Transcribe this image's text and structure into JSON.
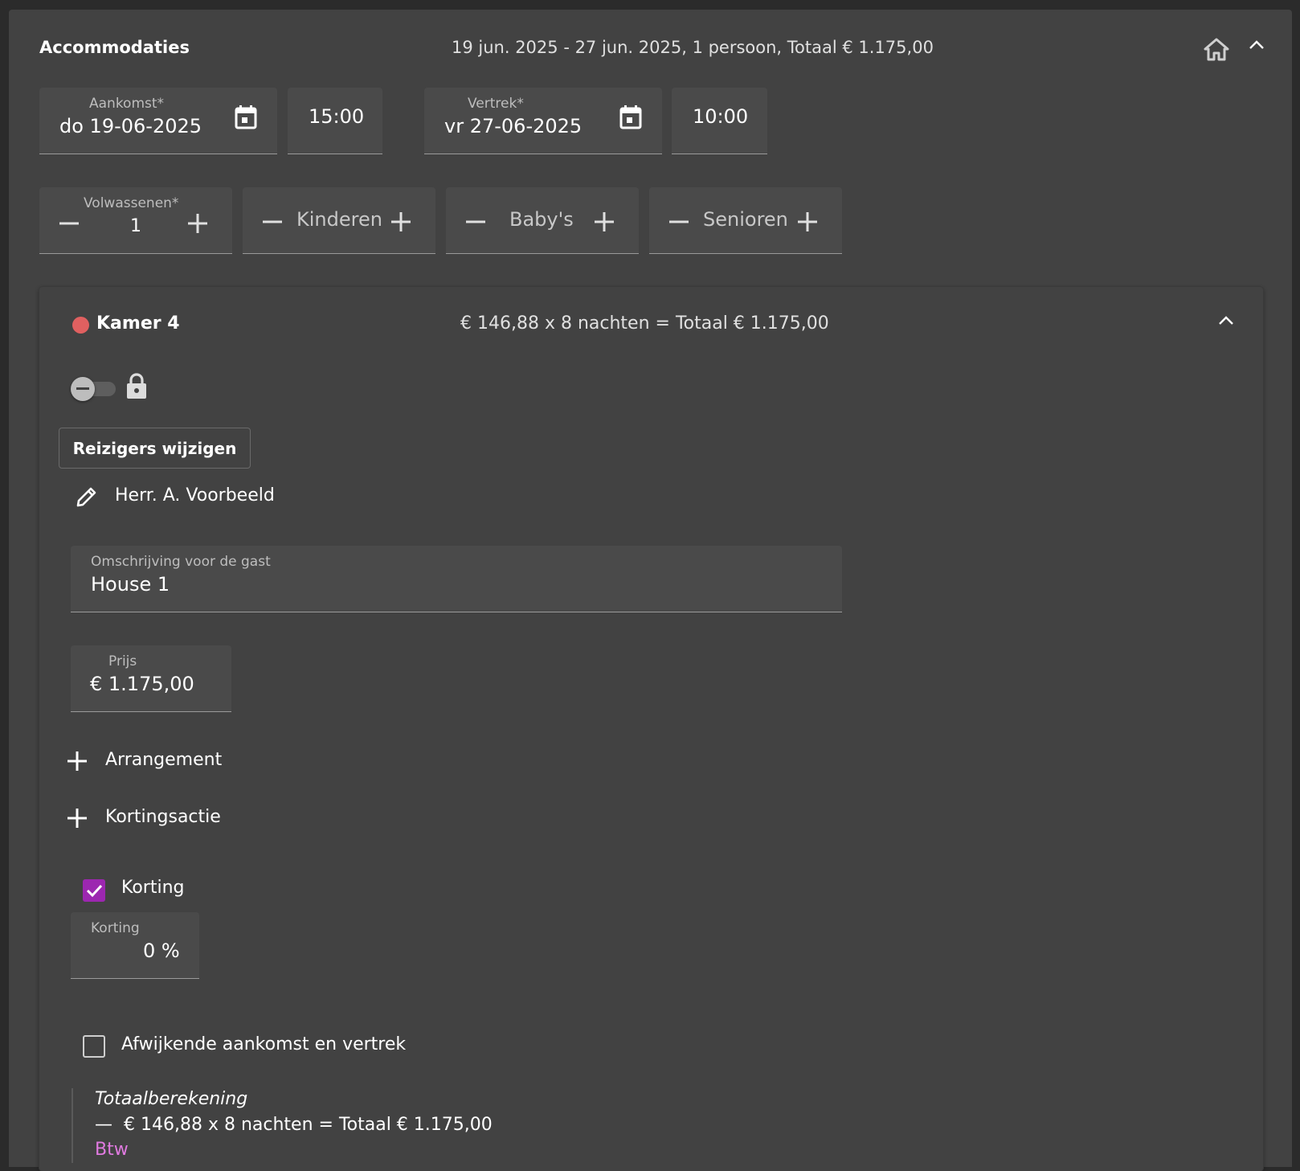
{
  "header": {
    "title": "Accommodaties",
    "summary": "19 jun. 2025 - 27 jun. 2025, 1 persoon, Totaal € 1.175,00"
  },
  "dates": {
    "arrival_label": "Aankomst*",
    "arrival_value": "do 19-06-2025",
    "arrival_time": "15:00",
    "departure_label": "Vertrek*",
    "departure_value": "vr 27-06-2025",
    "departure_time": "10:00"
  },
  "guests": {
    "adults_label": "Volwassenen*",
    "adults_value": "1",
    "children_label": "Kinderen",
    "babies_label": "Baby's",
    "seniors_label": "Senioren"
  },
  "room": {
    "name": "Kamer 4",
    "status_color": "#e06060",
    "summary": "€ 146,88 x 8 nachten = Totaal € 1.175,00",
    "change_travelers_label": "Reizigers wijzigen",
    "traveler_name": "Herr. A. Voorbeeld",
    "description_label": "Omschrijving voor de gast",
    "description_value": "House 1",
    "price_label": "Prijs",
    "price_value": "€ 1.175,00",
    "add_arrangement_label": "Arrangement",
    "add_discount_action_label": "Kortingsactie",
    "discount_checkbox_label": "Korting",
    "discount_checked": true,
    "discount_field_label": "Korting",
    "discount_field_value": "0 %",
    "deviating_label": "Afwijkende aankomst en vertrek",
    "deviating_checked": false,
    "calc_title": "Totaalberekening",
    "calc_line": "—  € 146,88 x 8 nachten = Totaal € 1.175,00",
    "vat_label": "Btw"
  },
  "colors": {
    "accent": "#9c27b0",
    "link": "#e07ae0",
    "status_dot": "#e06060"
  }
}
